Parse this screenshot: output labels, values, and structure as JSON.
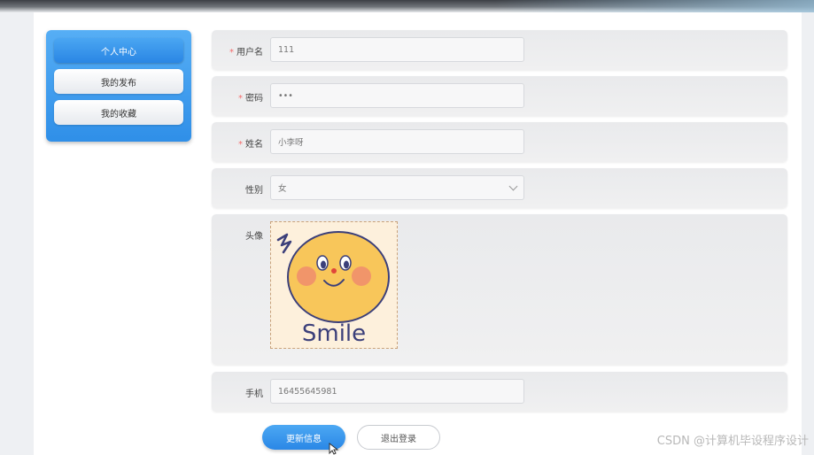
{
  "sidebar": {
    "items": [
      {
        "label": "个人中心",
        "active": true
      },
      {
        "label": "我的发布",
        "active": false
      },
      {
        "label": "我的收藏",
        "active": false
      }
    ]
  },
  "form": {
    "username": {
      "label": "用户名",
      "required": true,
      "value": "111"
    },
    "password": {
      "label": "密码",
      "required": true,
      "value": "•••"
    },
    "name": {
      "label": "姓名",
      "required": true,
      "value": "小李呀"
    },
    "gender": {
      "label": "性别",
      "value": "女"
    },
    "avatar": {
      "label": "头像",
      "image_text": "Smile"
    },
    "phone": {
      "label": "手机",
      "value": "16455645981"
    },
    "required_mark": "*"
  },
  "buttons": {
    "update": "更新信息",
    "logout": "退出登录"
  },
  "watermark": "CSDN @计算机毕设程序设计",
  "colors": {
    "primary": "#2f8fe8",
    "required": "#f56c6c",
    "row_bg": "#ececee"
  }
}
